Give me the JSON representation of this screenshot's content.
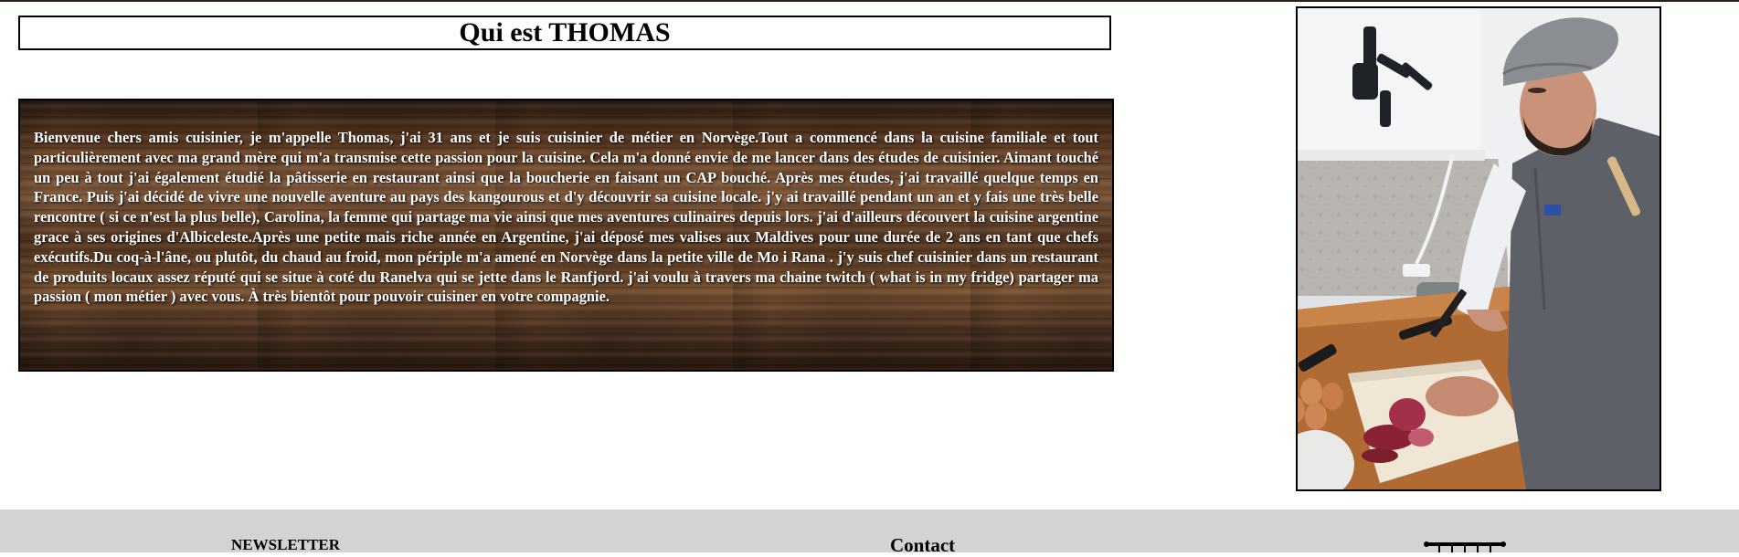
{
  "header": {
    "title": "Qui est THOMAS"
  },
  "bio": {
    "text": "Bienvenue chers amis cuisinier, je m'appelle Thomas, j'ai 31 ans et je suis cuisinier de métier en Norvège.Tout a commencé dans la cuisine familiale et tout particulièrement avec ma grand mère qui m'a transmise cette passion pour la cuisine. Cela m'a donné envie de me lancer dans des études de cuisinier. Aimant touché un peu à tout j'ai également étudié la pâtisserie en restaurant ainsi que la boucherie en faisant un CAP bouché. Après mes études, j'ai travaillé quelque temps en France. Puis j'ai décidé de vivre une nouvelle aventure au pays des kangourous et d'y découvrir sa cuisine locale. j'y ai travaillé pendant un an et y fais une très belle rencontre ( si ce n'est la plus belle), Carolina, la femme qui partage ma vie ainsi que mes aventures culinaires depuis lors. j'ai d'ailleurs découvert la cuisine argentine grace à ses origines d'Albiceleste.Après une petite mais riche année en Argentine, j'ai déposé mes valises aux Maldives pour une durée de 2 ans en tant que chefs exécutifs.Du coq-à-l'âne, ou plutôt, du chaud au froid, mon périple m'a amené en Norvège dans la petite ville de Mo i Rana . j'y suis chef cuisinier dans un restaurant de produits locaux assez réputé qui se situe à coté du Ranelva qui se jette dans le Ranfjord. j'ai voulu à travers ma chaine twitch ( what is in my fridge) partager ma passion ( mon métier ) avec vous. À très bientôt pour pouvoir cuisiner en votre compagnie."
  },
  "photo": {
    "subject": "chef-cutting-onion"
  },
  "footer": {
    "newsletter_label": "NEWSLETTER",
    "contact_label": "Contact",
    "logo_icon": "utensil-rack-logo-icon"
  },
  "colors": {
    "footer_bg": "#d3d3d3",
    "bio_text": "#ffffff"
  }
}
